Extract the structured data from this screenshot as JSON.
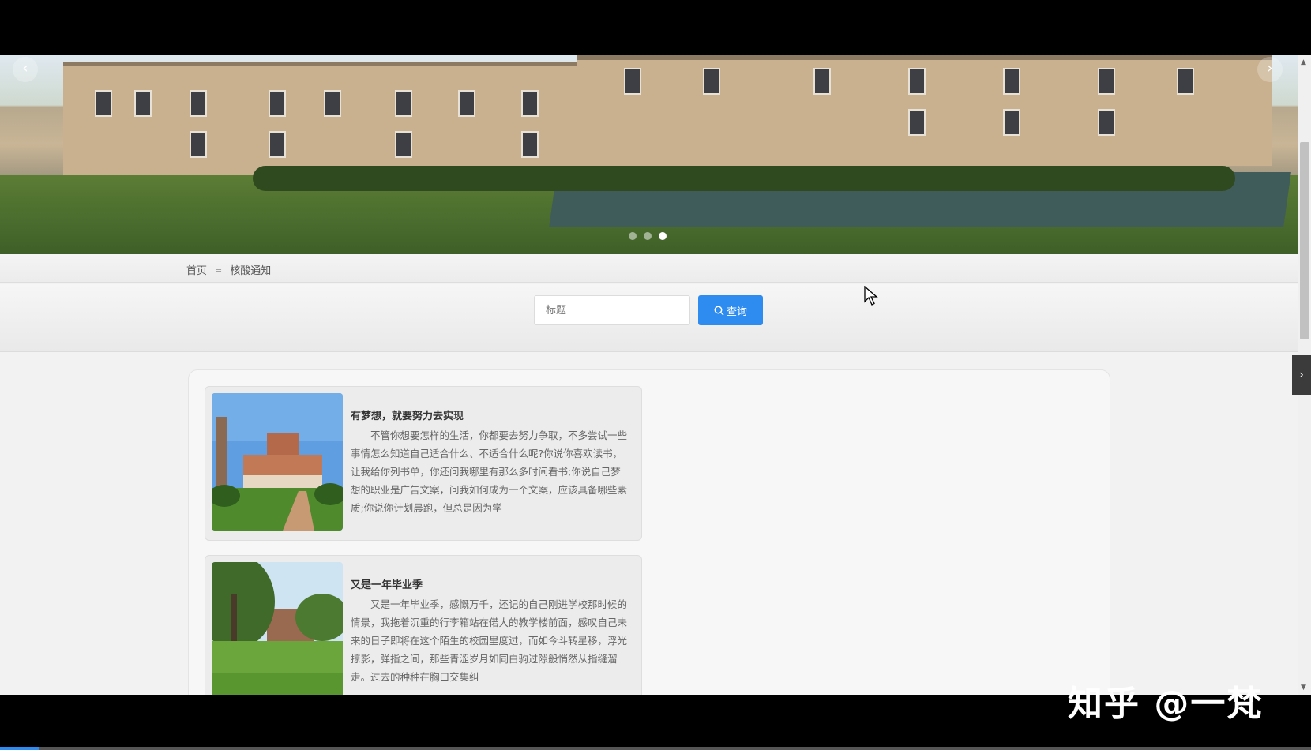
{
  "banner": {
    "prev_icon": "chevron-left-icon",
    "next_icon": "chevron-right-icon",
    "slide_count": 3,
    "active_slide": 3
  },
  "breadcrumb": {
    "home": "首页",
    "separator": "≡",
    "current": "核酸通知"
  },
  "search": {
    "placeholder": "标题",
    "button_label": "查询",
    "button_icon": "search-icon"
  },
  "articles": [
    {
      "title": "有梦想，就要努力去实现",
      "description": "不管你想要怎样的生活，你都要去努力争取，不多尝试一些事情怎么知道自己适合什么、不适合什么呢?你说你喜欢读书，让我给你列书单，你还问我哪里有那么多时间看书;你说自己梦想的职业是广告文案，问我如何成为一个文案，应该具备哪些素质;你说你计划晨跑，但总是因为学",
      "image": "campus-building-photo"
    },
    {
      "title": "又是一年毕业季",
      "description": "又是一年毕业季，感慨万千，还记的自己刚进学校那时候的情景，我拖着沉重的行李箱站在偌大的教学楼前面，感叹自己未来的日子即将在这个陌生的校园里度过，而如今斗转星移，浮光掠影，弹指之间，那些青涩岁月如同白驹过隙般悄然从指缝溜走。过去的种种在胸口交集纠",
      "image": "campus-lawn-photo"
    }
  ],
  "watermark": "知乎 @一梵",
  "colors": {
    "accent": "#2e8cf0",
    "card_bg": "#ececec"
  },
  "video_progress": 0.03
}
